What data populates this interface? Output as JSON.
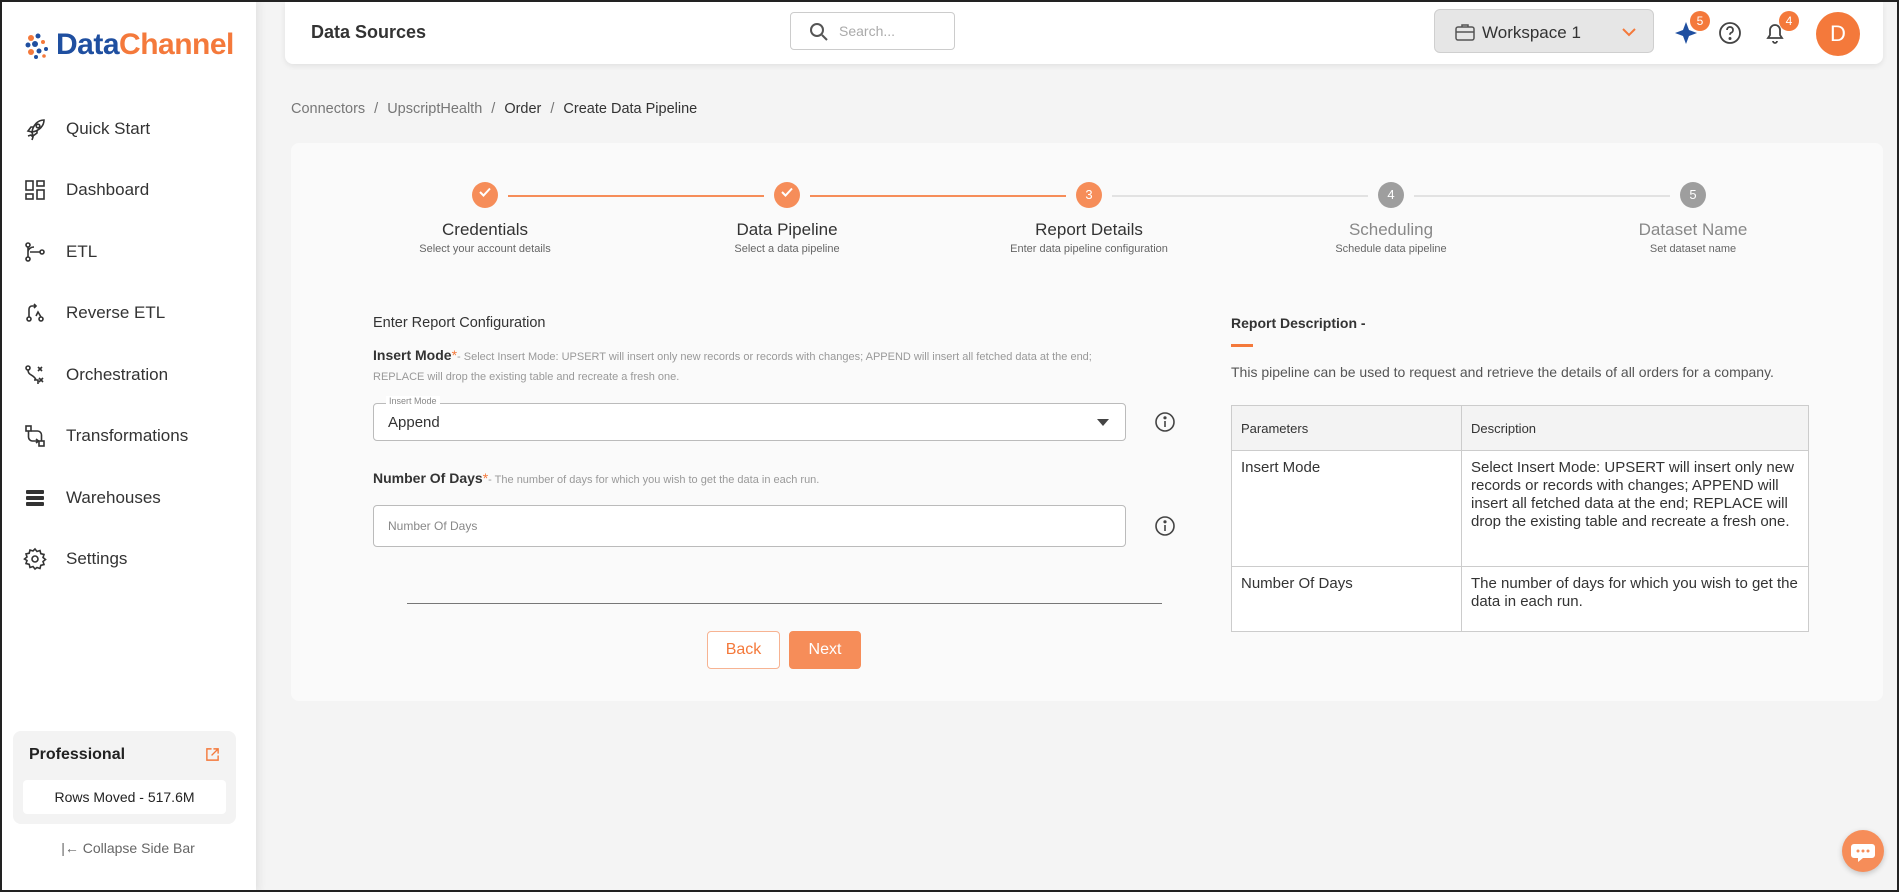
{
  "brand": {
    "part1": "Data",
    "part2": "Channel"
  },
  "sidebar": {
    "items": [
      {
        "label": "Quick Start",
        "icon": "rocket-icon"
      },
      {
        "label": "Dashboard",
        "icon": "dashboard-icon"
      },
      {
        "label": "ETL",
        "icon": "etl-icon"
      },
      {
        "label": "Reverse ETL",
        "icon": "reverse-etl-icon"
      },
      {
        "label": "Orchestration",
        "icon": "orchestration-icon"
      },
      {
        "label": "Transformations",
        "icon": "transformations-icon"
      },
      {
        "label": "Warehouses",
        "icon": "warehouses-icon"
      },
      {
        "label": "Settings",
        "icon": "gear-icon"
      }
    ],
    "plan": {
      "name": "Professional",
      "rows_moved": "Rows Moved - 517.6M"
    },
    "collapse_label": "Collapse Side Bar"
  },
  "header": {
    "title": "Data Sources",
    "search_placeholder": "Search...",
    "workspace": "Workspace 1",
    "sparkle_badge": "5",
    "notification_badge": "4",
    "avatar_initial": "D"
  },
  "breadcrumb": [
    "Connectors",
    "UpscriptHealth",
    "Order",
    "Create Data Pipeline"
  ],
  "stepper": [
    {
      "title": "Credentials",
      "subtitle": "Select your account details",
      "state": "done",
      "marker": ""
    },
    {
      "title": "Data Pipeline",
      "subtitle": "Select a data pipeline",
      "state": "done",
      "marker": ""
    },
    {
      "title": "Report Details",
      "subtitle": "Enter data pipeline configuration",
      "state": "active",
      "marker": "3"
    },
    {
      "title": "Scheduling",
      "subtitle": "Schedule data pipeline",
      "state": "pending",
      "marker": "4"
    },
    {
      "title": "Dataset Name",
      "subtitle": "Set dataset name",
      "state": "pending",
      "marker": "5"
    }
  ],
  "form": {
    "section_title": "Enter Report Configuration",
    "insert_mode": {
      "label": "Insert Mode",
      "required": "*",
      "hint": "- Select Insert Mode: UPSERT will insert only new records or records with changes; APPEND will insert all fetched data at the end; REPLACE will drop the existing table and recreate a fresh one.",
      "float_label": "Insert Mode",
      "value": "Append"
    },
    "days": {
      "label": "Number Of Days",
      "required": "*",
      "hint": "- The number of days for which you wish to get the data in each run.",
      "placeholder": "Number Of Days",
      "value": ""
    },
    "back_label": "Back",
    "next_label": "Next"
  },
  "report": {
    "title": "Report Description -",
    "text": "This pipeline can be used to request and retrieve the details of all orders for a company.",
    "headers": [
      "Parameters",
      "Description"
    ],
    "rows": [
      {
        "param": "Insert Mode",
        "desc": "Select Insert Mode: UPSERT will insert only new records or records with changes; APPEND will insert all fetched data at the end; REPLACE will drop the existing table and recreate a fresh one."
      },
      {
        "param": "Number Of Days",
        "desc": "The number of days for which you wish to get the data in each run."
      }
    ]
  },
  "colors": {
    "accent": "#f4793b",
    "brand_blue": "#1f4fa0",
    "done": "#f68d59",
    "pending": "#9e9e9e"
  }
}
